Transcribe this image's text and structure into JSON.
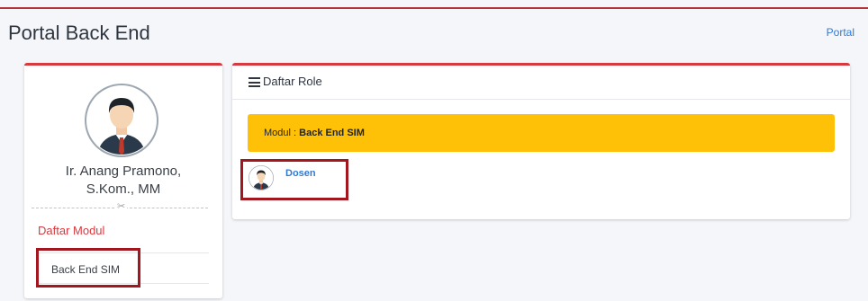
{
  "header": {
    "title": "Portal Back End",
    "breadcrumb": "Portal"
  },
  "profile": {
    "name_line1": "Ir. Anang Pramono,",
    "name_line2": "S.Kom., MM",
    "divider_symbol": "✂",
    "module_list_title": "Daftar Modul",
    "modules": [
      {
        "label": "Back End SIM"
      }
    ]
  },
  "main": {
    "header_title": "Daftar Role",
    "alert": {
      "prefix": "Modul : ",
      "module": "Back End SIM"
    },
    "roles": [
      {
        "label": "Dosen"
      }
    ]
  },
  "colors": {
    "accent": "#d63a3f",
    "highlight": "#a3161d",
    "alert_bg": "#ffc107",
    "link": "#2f7ad6"
  },
  "icons": [
    "user-avatar-icon",
    "scissors-icon",
    "menu-icon"
  ]
}
